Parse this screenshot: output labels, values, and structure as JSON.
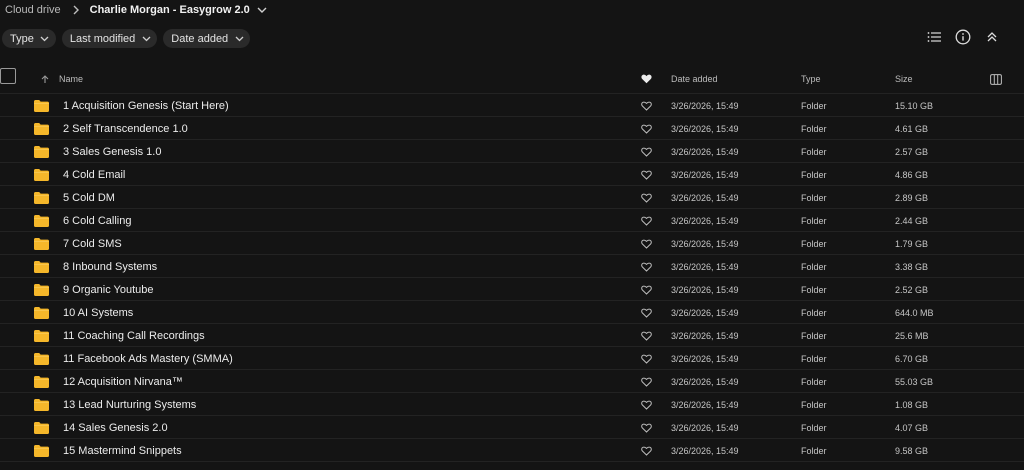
{
  "breadcrumb": {
    "root": "Cloud drive",
    "current": "Charlie Morgan - Easygrow 2.0"
  },
  "filters": [
    "Type",
    "Last modified",
    "Date added"
  ],
  "toolbar_icons": [
    "list-view-icon",
    "info-icon",
    "collapse-icon"
  ],
  "columns": {
    "name": "Name",
    "date_added": "Date added",
    "type": "Type",
    "size": "Size"
  },
  "colors": {
    "background": "#141414",
    "folder": "#f5b72a",
    "chip": "#2a2a2a",
    "divider": "#232323"
  },
  "rows": [
    {
      "name": "1 Acquisition Genesis (Start Here)",
      "date": "3/26/2026, 15:49",
      "type": "Folder",
      "size": "15.10 GB"
    },
    {
      "name": "2 Self Transcendence 1.0",
      "date": "3/26/2026, 15:49",
      "type": "Folder",
      "size": "4.61 GB"
    },
    {
      "name": "3 Sales Genesis 1.0",
      "date": "3/26/2026, 15:49",
      "type": "Folder",
      "size": "2.57 GB"
    },
    {
      "name": "4 Cold Email",
      "date": "3/26/2026, 15:49",
      "type": "Folder",
      "size": "4.86 GB"
    },
    {
      "name": "5 Cold DM",
      "date": "3/26/2026, 15:49",
      "type": "Folder",
      "size": "2.89 GB"
    },
    {
      "name": "6 Cold Calling",
      "date": "3/26/2026, 15:49",
      "type": "Folder",
      "size": "2.44 GB"
    },
    {
      "name": "7 Cold SMS",
      "date": "3/26/2026, 15:49",
      "type": "Folder",
      "size": "1.79 GB"
    },
    {
      "name": "8 Inbound Systems",
      "date": "3/26/2026, 15:49",
      "type": "Folder",
      "size": "3.38 GB"
    },
    {
      "name": "9 Organic Youtube",
      "date": "3/26/2026, 15:49",
      "type": "Folder",
      "size": "2.52 GB"
    },
    {
      "name": "10 AI Systems",
      "date": "3/26/2026, 15:49",
      "type": "Folder",
      "size": "644.0 MB"
    },
    {
      "name": "11 Coaching Call Recordings",
      "date": "3/26/2026, 15:49",
      "type": "Folder",
      "size": "25.6 MB"
    },
    {
      "name": "11 Facebook Ads Mastery (SMMA)",
      "date": "3/26/2026, 15:49",
      "type": "Folder",
      "size": "6.70 GB"
    },
    {
      "name": "12 Acquisition Nirvana™",
      "date": "3/26/2026, 15:49",
      "type": "Folder",
      "size": "55.03 GB"
    },
    {
      "name": "13 Lead Nurturing Systems",
      "date": "3/26/2026, 15:49",
      "type": "Folder",
      "size": "1.08 GB"
    },
    {
      "name": "14 Sales Genesis 2.0",
      "date": "3/26/2026, 15:49",
      "type": "Folder",
      "size": "4.07 GB"
    },
    {
      "name": "15 Mastermind Snippets",
      "date": "3/26/2026, 15:49",
      "type": "Folder",
      "size": "9.58 GB"
    }
  ]
}
